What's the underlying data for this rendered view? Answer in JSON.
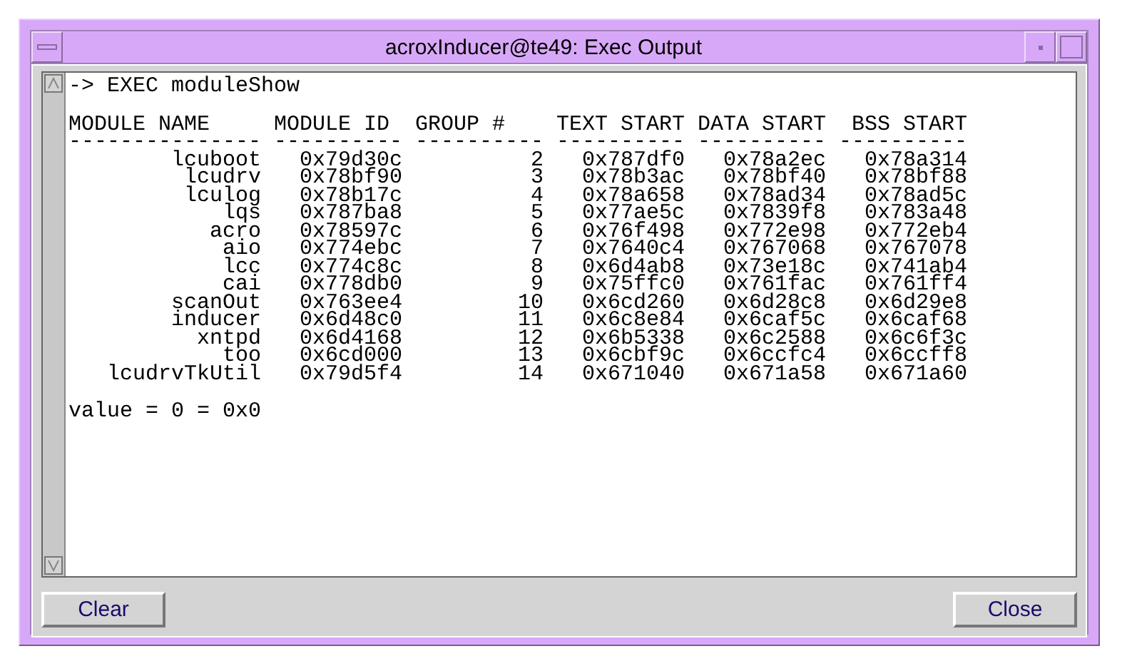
{
  "window": {
    "title": "acroxInducer@te49: Exec Output"
  },
  "output": {
    "command": "-> EXEC moduleShow",
    "columns": [
      "MODULE NAME",
      "MODULE ID",
      "GROUP #",
      "TEXT START",
      "DATA START",
      "BSS START"
    ],
    "separators": [
      "---------------",
      "----------",
      "----------",
      "----------",
      "----------",
      "----------"
    ],
    "rows": [
      [
        "lcuboot",
        "0x79d30c",
        "2",
        "0x787df0",
        "0x78a2ec",
        "0x78a314"
      ],
      [
        "lcudrv",
        "0x78bf90",
        "3",
        "0x78b3ac",
        "0x78bf40",
        "0x78bf88"
      ],
      [
        "lculog",
        "0x78b17c",
        "4",
        "0x78a658",
        "0x78ad34",
        "0x78ad5c"
      ],
      [
        "lqs",
        "0x787ba8",
        "5",
        "0x77ae5c",
        "0x7839f8",
        "0x783a48"
      ],
      [
        "acro",
        "0x78597c",
        "6",
        "0x76f498",
        "0x772e98",
        "0x772eb4"
      ],
      [
        "aio",
        "0x774ebc",
        "7",
        "0x7640c4",
        "0x767068",
        "0x767078"
      ],
      [
        "lcc",
        "0x774c8c",
        "8",
        "0x6d4ab8",
        "0x73e18c",
        "0x741ab4"
      ],
      [
        "cai",
        "0x778db0",
        "9",
        "0x75ffc0",
        "0x761fac",
        "0x761ff4"
      ],
      [
        "scanOut",
        "0x763ee4",
        "10",
        "0x6cd260",
        "0x6d28c8",
        "0x6d29e8"
      ],
      [
        "inducer",
        "0x6d48c0",
        "11",
        "0x6c8e84",
        "0x6caf5c",
        "0x6caf68"
      ],
      [
        "xntpd",
        "0x6d4168",
        "12",
        "0x6b5338",
        "0x6c2588",
        "0x6c6f3c"
      ],
      [
        "too",
        "0x6cd000",
        "13",
        "0x6cbf9c",
        "0x6ccfc4",
        "0x6ccff8"
      ],
      [
        "lcudrvTkUtil",
        "0x79d5f4",
        "14",
        "0x671040",
        "0x671a58",
        "0x671a60"
      ]
    ],
    "result": "value = 0 = 0x0"
  },
  "buttons": [
    "Clear",
    "Close"
  ]
}
